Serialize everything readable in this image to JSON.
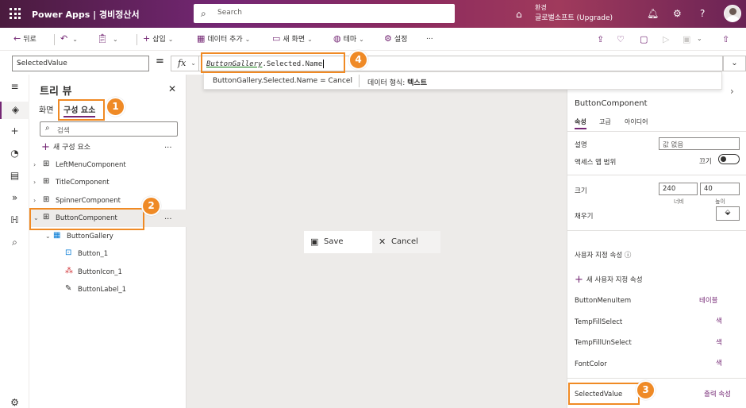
{
  "titlebar": {
    "app_name": "Power Apps  |  경비정산서",
    "search_placeholder": "Search",
    "env_label": "환경",
    "env_name": "글로벌소프트 (Upgrade)",
    "icons": [
      "waffle-icon",
      "search-icon",
      "environment-icon",
      "bell-icon",
      "gear-icon",
      "help-icon",
      "avatar"
    ]
  },
  "commandbar": {
    "back": "뒤로",
    "insert": "삽입",
    "add_data": "데이터 추가",
    "new_screen": "새 화면",
    "theme": "테마",
    "settings": "설정",
    "more": "..."
  },
  "formulabar": {
    "property": "SelectedValue",
    "equals": "=",
    "fx": "fx",
    "formula_object": "ButtonGallery",
    "formula_rest": ".Selected.Name",
    "result_expr": "ButtonGallery.Selected.Name  =  Cancel",
    "result_type_label": "데이터 형식: ",
    "result_type_value": "텍스트"
  },
  "tree": {
    "title": "트리 뷰",
    "tabs": [
      "화면",
      "구성 요소"
    ],
    "search_placeholder": "검색",
    "new_component": "새 구성 요소",
    "more": "...",
    "items": [
      {
        "label": "LeftMenuComponent"
      },
      {
        "label": "TitleComponent"
      },
      {
        "label": "SpinnerComponent"
      },
      {
        "label": "ButtonComponent"
      },
      {
        "label": "ButtonGallery"
      },
      {
        "label": "Button_1"
      },
      {
        "label": "ButtonIcon_1"
      },
      {
        "label": "ButtonLabel_1"
      }
    ]
  },
  "canvas": {
    "save_label": "Save",
    "cancel_label": "Cancel"
  },
  "properties": {
    "component_name": "ButtonComponent",
    "tabs": [
      "속성",
      "고급",
      "아이디어"
    ],
    "description_label": "설명",
    "description_placeholder": "값 없음",
    "access_label": "액세스 앱 범위",
    "access_state": "끄기",
    "size_label": "크기",
    "width_value": "240",
    "height_value": "40",
    "width_sub": "너비",
    "height_sub": "높이",
    "fill_label": "채우기",
    "custom_props_label": "사용자 지정 속성",
    "new_custom_prop": "새 사용자 지정 속성",
    "custom_props": [
      {
        "name": "ButtonMenuItem",
        "type": "테이블"
      },
      {
        "name": "TempFillSelect",
        "type": "색"
      },
      {
        "name": "TempFillUnSelect",
        "type": "색"
      },
      {
        "name": "FontColor",
        "type": "색"
      },
      {
        "name": "SelectedValue",
        "type": "출력 속성"
      }
    ]
  },
  "callouts": [
    "1",
    "2",
    "3",
    "4"
  ],
  "colors": {
    "accent": "#742774",
    "callout": "#ef8a26"
  }
}
